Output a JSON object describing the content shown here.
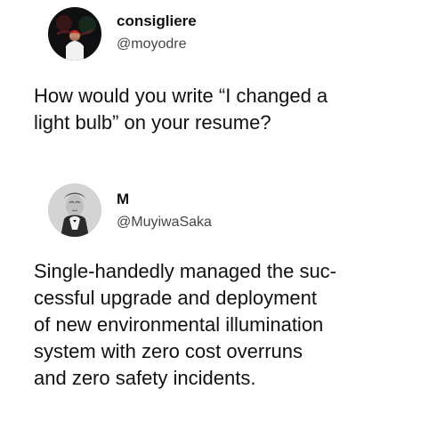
{
  "tweets": [
    {
      "display_name": "consigliere",
      "handle": "@moyodre",
      "avatar_icon": "profile-photo-icon",
      "text_lines": [
        "How would you write “I changed a",
        "light bulb” on your resume?"
      ]
    },
    {
      "display_name": "M",
      "handle": "@MuyiwaSaka",
      "avatar_icon": "portrait-photo-icon",
      "text_lines": [
        "Single-handedly managed the suc-",
        "cessful upgrade and deployment",
        "of new environmental illumination",
        "system with zero cost overruns",
        "and zero safety incidents."
      ]
    }
  ],
  "colors": {
    "background": "#ffffff",
    "text": "#111111",
    "handle": "#444444"
  }
}
